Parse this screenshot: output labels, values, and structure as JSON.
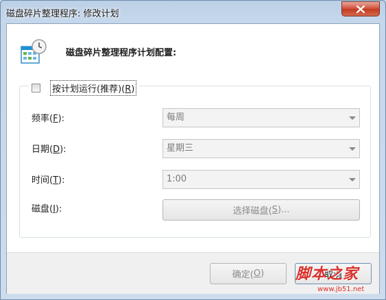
{
  "window": {
    "title": "磁盘碎片整理程序: 修改计划"
  },
  "header": {
    "text": "磁盘碎片整理程序计划配置:"
  },
  "schedule": {
    "checkbox_pre": "按计划运行(推荐)(",
    "checkbox_key": "R",
    "checkbox_post": ")",
    "checked": false
  },
  "fields": {
    "frequency": {
      "pre": "频率(",
      "key": "F",
      "post": "):",
      "value": "每周"
    },
    "date": {
      "pre": "日期(",
      "key": "D",
      "post": "):",
      "value": "星期三"
    },
    "time": {
      "pre": "时间(",
      "key": "T",
      "post": "):",
      "value": "1:00"
    },
    "disk": {
      "pre": "磁盘(",
      "key": "I",
      "post": "):"
    }
  },
  "buttons": {
    "select_disk": {
      "pre": "选择磁盘(",
      "key": "S",
      "post": ")..."
    },
    "ok": {
      "pre": "确定(",
      "key": "O",
      "post": ")"
    },
    "cancel": {
      "label": "取消"
    }
  },
  "watermark": {
    "text": "脚本之家",
    "url": "www.jb51.net"
  },
  "colors": {
    "close_button": "#c43a22",
    "watermark": "#d8312c"
  }
}
